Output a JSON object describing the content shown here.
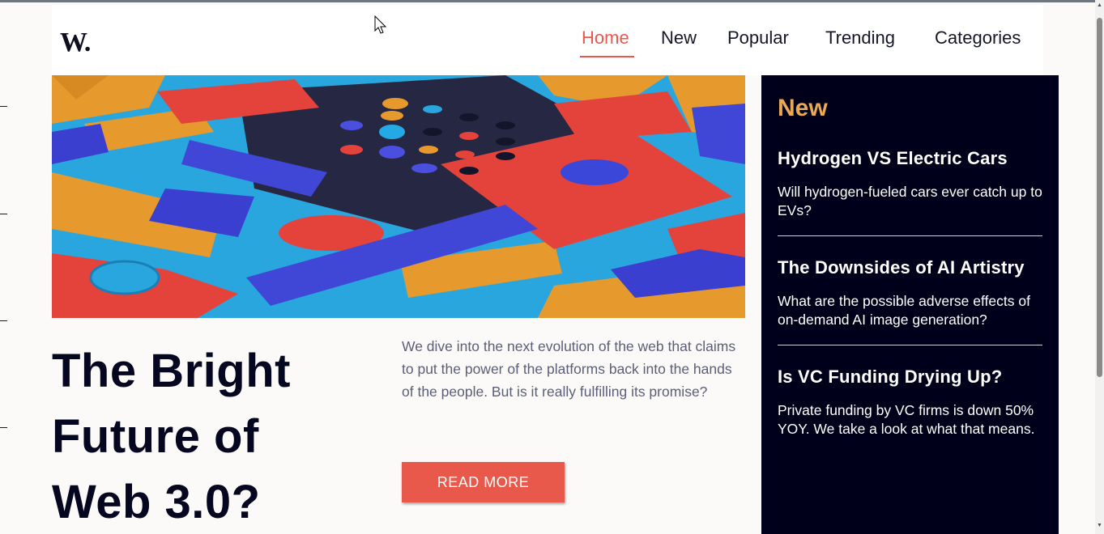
{
  "brand": {
    "logo_text": "W."
  },
  "nav": {
    "items": [
      {
        "label": "Home",
        "active": true
      },
      {
        "label": "New",
        "active": false
      },
      {
        "label": "Popular",
        "active": false
      },
      {
        "label": "Trending",
        "active": false
      },
      {
        "label": "Categories",
        "active": false
      }
    ]
  },
  "featured": {
    "headline_lines": [
      "The Bright",
      "Future of",
      "Web 3.0?"
    ],
    "teaser": "We dive into the next evolution of the web that claims to put the power of the platforms back into the hands of the people. But is it really fulfilling its promise?",
    "read_more_label": "READ MORE"
  },
  "sidebar": {
    "title": "New",
    "items": [
      {
        "title": "Hydrogen VS Electric Cars",
        "description": "Will hydrogen-fueled cars ever catch up to EVs?"
      },
      {
        "title": "The Downsides of AI Artistry",
        "description": "What are the possible adverse effects of on-demand AI image generation?"
      },
      {
        "title": "Is VC Funding Drying Up?",
        "description": "Private funding by VC firms is down 50% YOY. We take a look at what that means."
      }
    ]
  },
  "colors": {
    "accent": "#e8594b",
    "sidebar_bg": "#00001a",
    "sidebar_heading": "#e9a955",
    "headline": "#05061f"
  }
}
